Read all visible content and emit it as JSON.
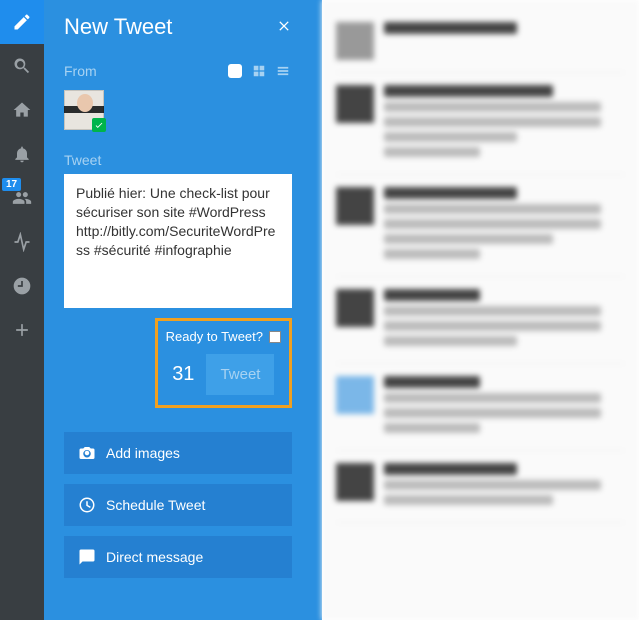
{
  "nav": {
    "notifications_badge": "17"
  },
  "panel": {
    "title": "New Tweet",
    "from_label": "From",
    "tweet_label": "Tweet",
    "tweet_text": "Publié hier: Une check-list pour sécuriser son site #WordPress http://bitly.com/SecuriteWordPress #sécurité #infographie",
    "ready_label": "Ready to Tweet?",
    "char_count": "31",
    "tweet_button": "Tweet",
    "add_images": "Add images",
    "schedule": "Schedule Tweet",
    "dm": "Direct message"
  }
}
